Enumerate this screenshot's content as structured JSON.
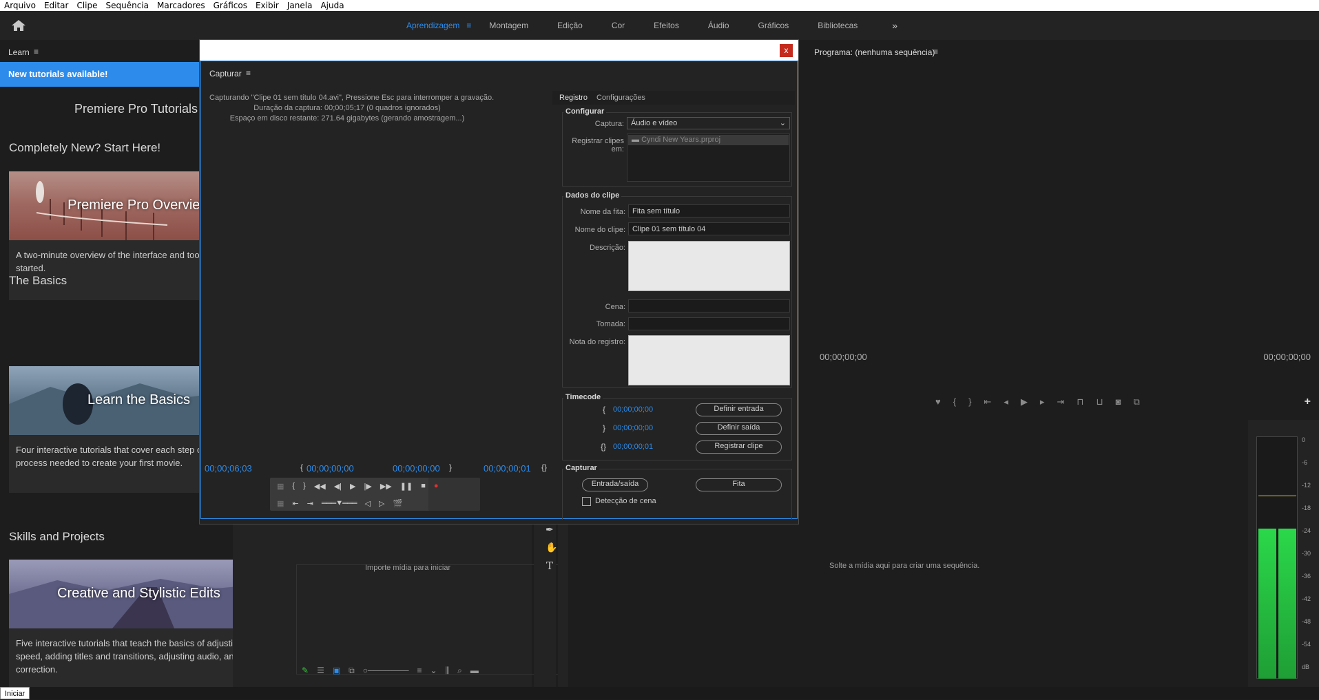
{
  "menu": [
    "Arquivo",
    "Editar",
    "Clipe",
    "Sequência",
    "Marcadores",
    "Gráficos",
    "Exibir",
    "Janela",
    "Ajuda"
  ],
  "workspaces": [
    "Aprendizagem",
    "Montagem",
    "Edição",
    "Cor",
    "Efeitos",
    "Áudio",
    "Gráficos",
    "Bibliotecas"
  ],
  "active_workspace": "Aprendizagem",
  "learn": {
    "panel_title": "Learn",
    "banner": "New tutorials available!",
    "heading": "Premiere Pro Tutorials",
    "sections": [
      {
        "title": "Completely New? Start Here!",
        "card_title": "Premiere Pro Overview",
        "desc": "A two-minute overview of the interface and tools needed to get started."
      },
      {
        "title": "The Basics",
        "card_title": "Learn the Basics",
        "desc": "Four interactive tutorials that cover each step of the editing process needed to create your first movie."
      },
      {
        "title": "Skills and Projects",
        "card_title": "Creative and Stylistic Edits",
        "desc": "Five interactive tutorials that teach the basics of adjusting clip speed, adding titles and transitions, adjusting audio, and color correction."
      }
    ]
  },
  "capture": {
    "panel_title": "Capturar",
    "close": "x",
    "status_line1": "Capturando \"Clipe 01 sem título 04.avi\", Pressione Esc para interromper a gravação.",
    "status_line2": "Duração da captura: 00;00;05;17  (0 quadros ignorados)",
    "status_line3": "Espaço em disco restante: 271.64 gigabytes (gerando amostragem...)",
    "tc_current": "00;00;06;03",
    "tc_in": "00;00;00;00",
    "tc_out": "00;00;00;00",
    "tc_duration": "00;00;00;01",
    "tabs": [
      "Registro",
      "Configurações"
    ],
    "configurar": {
      "title": "Configurar",
      "captura_label": "Captura:",
      "captura_value": "Áudio e vídeo",
      "registrar_label": "Registrar clipes em:",
      "project": "Cyndi New Years.prproj"
    },
    "dados": {
      "title": "Dados do clipe",
      "fita_label": "Nome da fita:",
      "fita_value": "Fita sem título",
      "clipe_label": "Nome do clipe:",
      "clipe_value": "Clipe 01 sem título 04",
      "descricao_label": "Descrição:",
      "cena_label": "Cena:",
      "tomada_label": "Tomada:",
      "nota_label": "Nota do registro:"
    },
    "timecode": {
      "title": "Timecode",
      "in": "00;00;00;00",
      "out": "00;00;00;00",
      "dur": "00;00;00;01",
      "btn_in": "Definir entrada",
      "btn_out": "Definir saída",
      "btn_log": "Registrar clipe"
    },
    "capturar": {
      "title": "Capturar",
      "btn_inout": "Entrada/saída",
      "btn_tape": "Fita",
      "scene_detect": "Detecção de cena"
    }
  },
  "program": {
    "title": "Programa: (nenhuma sequência)",
    "tc_left": "00;00;00;00",
    "tc_right": "00;00;00;00"
  },
  "project": {
    "import_hint": "Importe mídia para iniciar"
  },
  "timeline": {
    "drop_hint": "Solte a mídia aqui para criar uma sequência."
  },
  "meter_scale": [
    "0",
    "-6",
    "-12",
    "-18",
    "-24",
    "-30",
    "-36",
    "-42",
    "-48",
    "-54",
    "dB"
  ],
  "meter_level": 0.62,
  "status": {
    "iniciar": "Iniciar"
  }
}
